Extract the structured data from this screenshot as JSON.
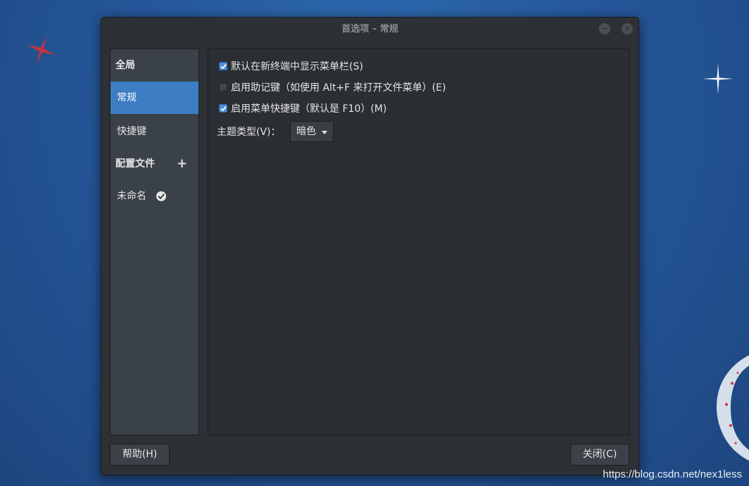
{
  "window": {
    "title": "首选项 – 常规",
    "minimize_icon": "minimize-icon",
    "close_icon": "close-icon"
  },
  "sidebar": {
    "global_header": "全局",
    "items": [
      {
        "label": "常规",
        "active": true
      },
      {
        "label": "快捷键",
        "active": false
      }
    ],
    "profiles_header": "配置文件",
    "add_icon": "plus-icon",
    "profile": {
      "label": "未命名",
      "icon": "check-circle-icon"
    }
  },
  "general": {
    "options": [
      {
        "label": "默认在新终端中显示菜单栏(S)",
        "checked": true
      },
      {
        "label": "启用助记键（如使用 Alt+F 来打开文件菜单）(E)",
        "checked": false
      },
      {
        "label": "启用菜单快捷键（默认是 F10）(M)",
        "checked": true
      }
    ],
    "theme_label": "主题类型(V)：",
    "theme_value": "暗色"
  },
  "footer": {
    "help_label": "帮助(H)",
    "close_label": "关闭(C)"
  },
  "watermark": "https://blog.csdn.net/nex1less",
  "colors": {
    "accent": "#3c7dc4",
    "checkbox": "#4b8fd6",
    "desktop": "#25579a"
  }
}
